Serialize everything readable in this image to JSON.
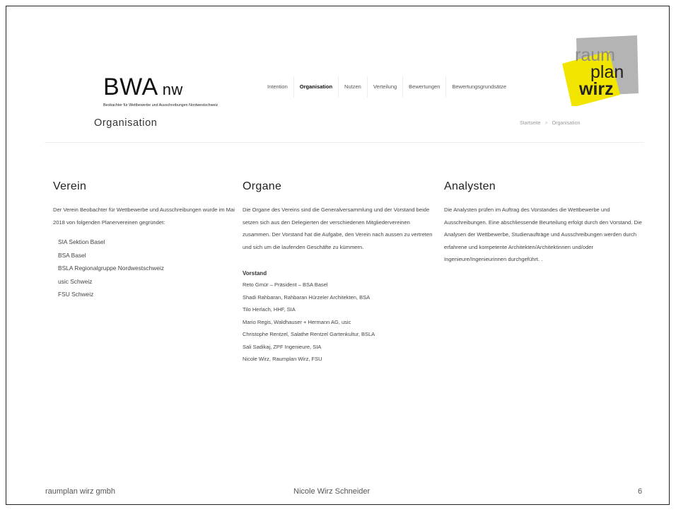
{
  "site": {
    "logo_main": "BWA",
    "logo_suffix": "nw",
    "logo_sub": "Beobachter für Wettbewerbe und Ausschreibungen Nordwestschweiz"
  },
  "nav": {
    "items": [
      {
        "label": "Intention"
      },
      {
        "label": "Organisation",
        "active": true
      },
      {
        "label": "Nutzen"
      },
      {
        "label": "Verteilung"
      },
      {
        "label": "Bewertungen"
      },
      {
        "label": "Bewertungsgrundsätze"
      }
    ]
  },
  "badge": {
    "line1": "raum",
    "line2": "plan",
    "line3": "wirz",
    "colors": {
      "yellow": "#f2e600",
      "grey": "#b4b4b4",
      "dark": "#222222",
      "text_light": "#8c8c8c"
    }
  },
  "page": {
    "title": "Organisation",
    "breadcrumb": {
      "home": "Startseite",
      "sep": ">",
      "current": "Organisation"
    }
  },
  "verein": {
    "heading": "Verein",
    "text": "Der Verein Beobachter für Wettbewerbe und Ausschreibungen wurde im Mai 2018 von folgenden Planervereinen gegründet:",
    "items": [
      "SIA Sektion Basel",
      "BSA Basel",
      "BSLA Regionalgruppe Nordwestschweiz",
      "usic Schweiz",
      "FSU Schweiz"
    ]
  },
  "organe": {
    "heading": "Organe",
    "text": "Die Organe des Vereins sind die Generalversammlung und der Vorstand beide setzen sich aus den Delegierten der verschiedenen Mitgliedervereinen zusammen. Der Vorstand hat die Aufgabe, den Verein nach aussen zu vertreten und sich um die laufenden Geschäfte zu kümmern.",
    "vorstand_title": "Vorstand",
    "vorstand": [
      "Reto Gmür – Präsident – BSA Basel",
      "Shadi Rahbaran, Rahbaran Hürzeler Architekten, BSA",
      "Tilo Herlach, HHF, SIA",
      "Mario Regis, Waldhauser + Hermann AG, usic",
      "Christophe Rentzel, Salathe Rentzel Gartenkultur, BSLA",
      "Sali Sadikaj, ZPF Ingenieure, SIA",
      "Nicole Wirz, Raumplan Wirz, FSU"
    ]
  },
  "analysten": {
    "heading": "Analysten",
    "text": "Die Analysten prüfen im Auftrag des Vorstandes die Wettbewerbe und Ausschreibungen. Eine abschliessende Beurteilung erfolgt durch den Vorstand. Die Analysen der Wettbewerbe, Studienaufträge und Ausschreibungen werden durch erfahrene und kompetente Architekten/Architektinnen und/oder Ingenieure/Ingenieurinnen durchgeführt. ."
  },
  "footer": {
    "left": "raumplan wirz gmbh",
    "center": "Nicole Wirz Schneider",
    "page_number": "6"
  }
}
